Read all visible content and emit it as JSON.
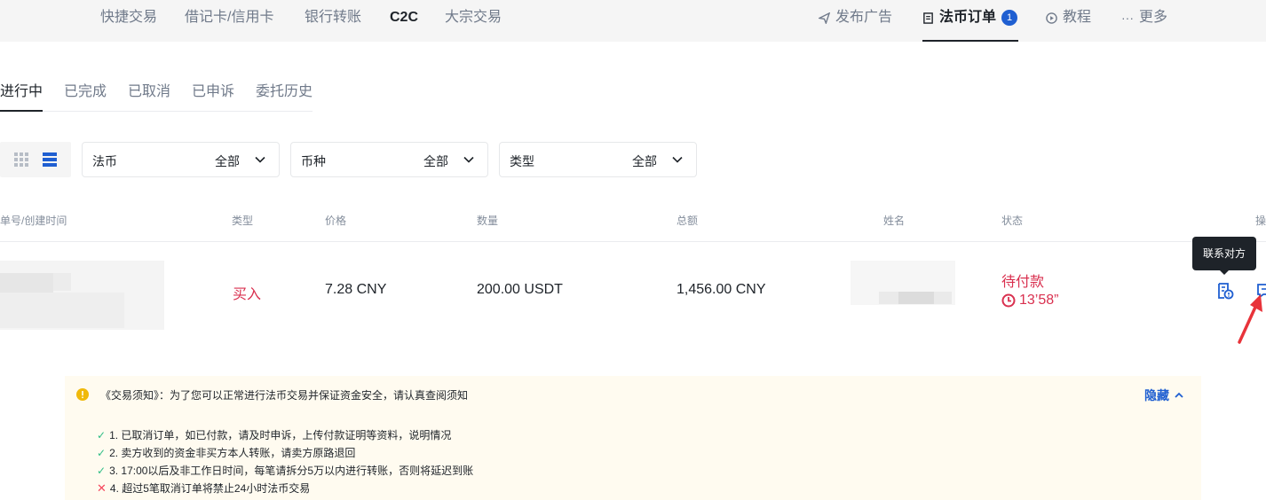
{
  "topnav": {
    "items": [
      "快捷交易",
      "借记卡/信用卡",
      "银行转账",
      "C2C",
      "大宗交易"
    ],
    "right": {
      "post_ad": "发布广告",
      "fiat_orders": "法币订单",
      "fiat_orders_badge": "1",
      "tutorial": "教程",
      "more": "更多"
    }
  },
  "subtabs": [
    "进行中",
    "已完成",
    "已取消",
    "已申诉",
    "委托历史"
  ],
  "filters": [
    {
      "label": "法币",
      "value": "全部"
    },
    {
      "label": "币种",
      "value": "全部"
    },
    {
      "label": "类型",
      "value": "全部"
    }
  ],
  "table": {
    "headers": {
      "order": "单号/创建时间",
      "type": "类型",
      "price": "价格",
      "amount": "数量",
      "total": "总额",
      "name": "姓名",
      "status": "状态",
      "action": "操"
    },
    "row": {
      "type": "买入",
      "price": "7.28 CNY",
      "amount": "200.00 USDT",
      "total": "1,456.00 CNY",
      "status": "待付款",
      "timer": "13’58”"
    }
  },
  "tooltip": "联系对方",
  "notice": {
    "title": "《交易须知》：为了您可以正常进行法币交易并保证资金安全，请认真查阅须知",
    "hide": "隐藏",
    "rules": [
      {
        "ok": true,
        "text": "1. 已取消订单，如已付款，请及时申诉，上传付款证明等资料，说明情况"
      },
      {
        "ok": true,
        "text": "2. 卖方收到的资金非买方本人转账，请卖方原路退回"
      },
      {
        "ok": true,
        "text": "3. 17:00以后及非工作日时间，每笔请拆分5万以内进行转账，否则将延迟到账"
      },
      {
        "ok": false,
        "text": "4. 超过5笔取消订单将禁止24小时法币交易"
      }
    ]
  },
  "colors": {
    "accent_blue": "#1f5fd1",
    "sell_red": "#d9304f",
    "check_green": "#2ebd85",
    "arrow_red": "#e8333a"
  }
}
